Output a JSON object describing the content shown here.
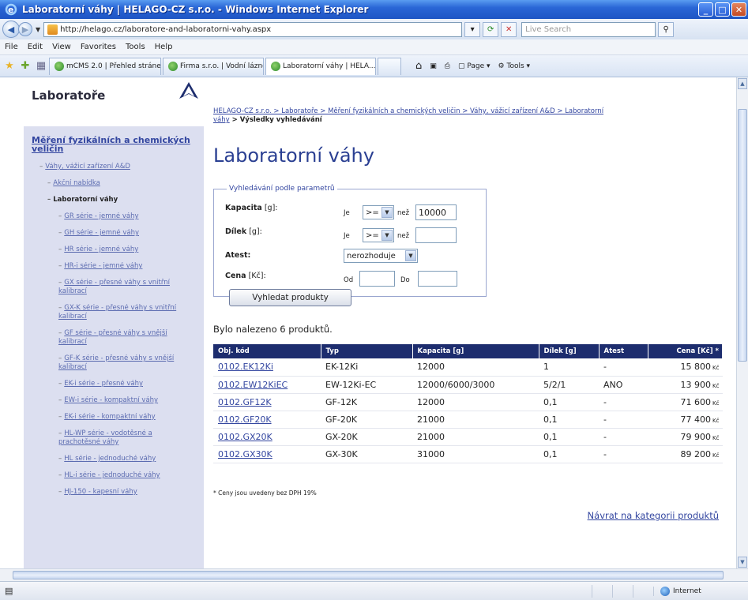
{
  "window": {
    "title": "Laboratorní váhy | HELAGO-CZ s.r.o. - Windows Internet Explorer"
  },
  "addressbar": {
    "url": "http://helago.cz/laboratore-and-laboratorni-vahy.aspx",
    "search_placeholder": "Live Search"
  },
  "menu": [
    "File",
    "Edit",
    "View",
    "Favorites",
    "Tools",
    "Help"
  ],
  "tabs": [
    {
      "label": "mCMS 2.0 | Přehled stránek",
      "active": false
    },
    {
      "label": "Firma s.r.o. | Vodní lázně",
      "active": false
    },
    {
      "label": "Laboratorní váhy | HELA...",
      "active": true
    }
  ],
  "commandbar": {
    "page": "Page",
    "tools": "Tools"
  },
  "status": {
    "zone": "Internet"
  },
  "sidebar": {
    "title": "Laboratoře",
    "items": [
      {
        "label": "Měření fyzikálních a chemických veličin",
        "level": 1
      },
      {
        "label": "Váhy, vážicí zařízení A&D",
        "level": 2
      },
      {
        "label": "Akční nabídka",
        "level": 3
      },
      {
        "label": "Laboratorní váhy",
        "level": 3,
        "active": true
      },
      {
        "label": "GR série - jemné váhy",
        "level": 4
      },
      {
        "label": "GH série - jemné váhy",
        "level": 4
      },
      {
        "label": "HR série - jemné váhy",
        "level": 4
      },
      {
        "label": "HR-i série - jemné váhy",
        "level": 4
      },
      {
        "label": "GX série - přesné váhy s vnitřní kalibrací",
        "level": 4
      },
      {
        "label": "GX-K série - přesné váhy s vnitřní kalibrací",
        "level": 4
      },
      {
        "label": "GF série - přesné váhy s vnější kalibrací",
        "level": 4
      },
      {
        "label": "GF-K série - přesné váhy s vnější kalibrací",
        "level": 4
      },
      {
        "label": "EK-i série - přesné váhy",
        "level": 4
      },
      {
        "label": "EW-i série - kompaktní váhy",
        "level": 4
      },
      {
        "label": "EK-i série - kompaktní váhy",
        "level": 4
      },
      {
        "label": "HL-WP série - vodotěsné a prachotěsné váhy",
        "level": 4
      },
      {
        "label": "HL série - jednoduché váhy",
        "level": 4
      },
      {
        "label": "HL-i série - jednoduché váhy",
        "level": 4
      },
      {
        "label": "HJ-150 - kapesní váhy",
        "level": 4
      }
    ]
  },
  "breadcrumb": {
    "line1": "HELAGO-CZ s.r.o. > Laboratoře > Měření fyzikálních a chemických veličin > Váhy, vážicí zařízení A&D > Laboratorní",
    "line2_link": "váhy",
    "line2_current": " > Výsledky vyhledávání"
  },
  "heading": "Laboratorní váhy",
  "filter": {
    "legend": "Vyhledávání podle parametrů",
    "rows": [
      {
        "label": "Kapacita",
        "unit": " [g]:",
        "op_label": "Je",
        "op": ">=",
        "than": "než",
        "value": "10000"
      },
      {
        "label": "Dílek",
        "unit": " [g]:",
        "op_label": "Je",
        "op": ">=",
        "than": "než",
        "value": ""
      },
      {
        "label": "Atest:",
        "unit": "",
        "select": "nerozhoduje"
      },
      {
        "label": "Cena",
        "unit": " [Kč]:",
        "from_label": "Od",
        "to_label": "Do",
        "from": "",
        "to": ""
      }
    ],
    "button": "Vyhledat produkty"
  },
  "found": "Bylo nalezeno 6 produktů.",
  "table": {
    "headers": [
      "Obj. kód",
      "Typ",
      "Kapacita [g]",
      "Dílek [g]",
      "Atest",
      "Cena [Kč] *"
    ],
    "rows": [
      [
        "0102.EK12Ki",
        "EK-12Ki",
        "12000",
        "1",
        "-",
        "15 800"
      ],
      [
        "0102.EW12KiEC",
        "EW-12Ki-EC",
        "12000/6000/3000",
        "5/2/1",
        "ANO",
        "13 900"
      ],
      [
        "0102.GF12K",
        "GF-12K",
        "12000",
        "0,1",
        "-",
        "71 600"
      ],
      [
        "0102.GF20K",
        "GF-20K",
        "21000",
        "0,1",
        "-",
        "77 400"
      ],
      [
        "0102.GX20K",
        "GX-20K",
        "21000",
        "0,1",
        "-",
        "79 900"
      ],
      [
        "0102.GX30K",
        "GX-30K",
        "31000",
        "0,1",
        "-",
        "89 200"
      ]
    ],
    "currency": "Kč"
  },
  "note": "* Ceny jsou uvedeny bez DPH 19%",
  "backlink": "Návrat na kategorii produktů"
}
